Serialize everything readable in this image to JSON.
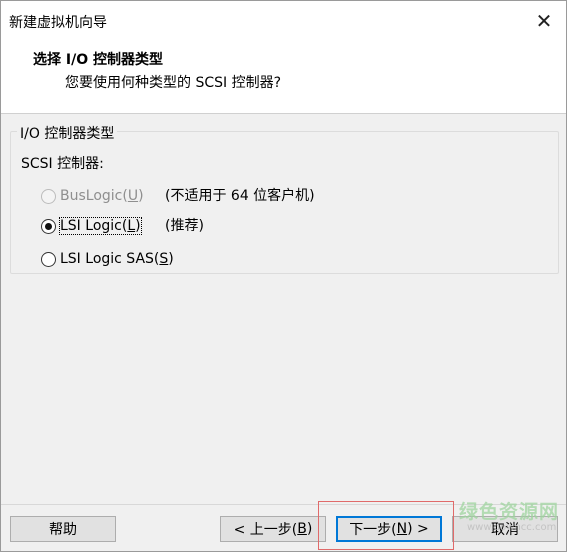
{
  "window": {
    "title": "新建虚拟机向导",
    "close_glyph": "✕"
  },
  "header": {
    "title": "选择 I/O 控制器类型",
    "subtitle": "您要使用何种类型的 SCSI 控制器?"
  },
  "group": {
    "legend": "I/O 控制器类型",
    "scsi_label": "SCSI 控制器:"
  },
  "options": [
    {
      "label_pre": "BusLogic(",
      "mnemonic": "U",
      "label_post": ")",
      "note": "(不适用于 64 位客户机)",
      "checked": false,
      "disabled": true
    },
    {
      "label_pre": "LSI Logic(",
      "mnemonic": "L",
      "label_post": ")",
      "note": "(推荐)",
      "checked": true,
      "disabled": false
    },
    {
      "label_pre": "LSI Logic SAS(",
      "mnemonic": "S",
      "label_post": ")",
      "note": "",
      "checked": false,
      "disabled": false
    }
  ],
  "buttons": {
    "help": "帮助",
    "back_pre": "< 上一步(",
    "back_mn": "B",
    "back_post": ")",
    "next_pre": "下一步(",
    "next_mn": "N",
    "next_post": ") >",
    "cancel": "取消"
  },
  "watermark": {
    "text": "绿色资源网",
    "url": "www.downcc.com"
  },
  "colors": {
    "focus_border": "#0078d7",
    "highlight_box": "#e06a6a"
  }
}
